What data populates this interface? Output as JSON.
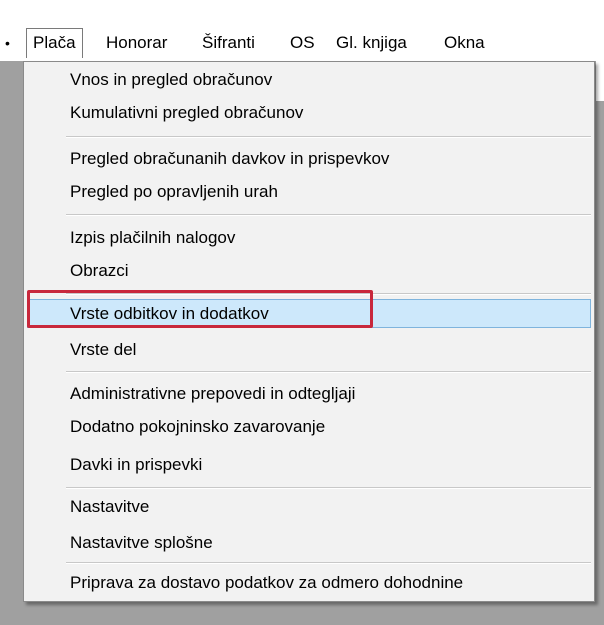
{
  "menubar": {
    "edge_dot": "•",
    "items": [
      {
        "label": "Plača",
        "active": true
      },
      {
        "label": "Honorar",
        "active": false
      },
      {
        "label": "Šifranti",
        "active": false
      },
      {
        "label": "OS",
        "active": false
      },
      {
        "label": "Gl. knjiga",
        "active": false
      },
      {
        "label": "Okna",
        "active": false
      }
    ]
  },
  "dropdown": {
    "items": [
      {
        "label": "Vnos in pregled obračunov"
      },
      {
        "label": "Kumulativni pregled obračunov"
      },
      {
        "label": "Pregled obračunanih davkov in prispevkov"
      },
      {
        "label": "Pregled po opravljenih urah"
      },
      {
        "label": "Izpis plačilnih nalogov"
      },
      {
        "label": "Obrazci"
      },
      {
        "label": "Vrste odbitkov in dodatkov",
        "highlighted": true
      },
      {
        "label": "Vrste del"
      },
      {
        "label": "Administrativne prepovedi in odtegljaji"
      },
      {
        "label": "Dodatno pokojninsko zavarovanje"
      },
      {
        "label": "Davki in prispevki"
      },
      {
        "label": "Nastavitve"
      },
      {
        "label": "Nastavitve splošne"
      },
      {
        "label": "Priprava za dostavo podatkov za odmero dohodnine"
      }
    ]
  },
  "colors": {
    "highlight_bg": "#cde8fb",
    "highlight_border": "#7fb4dd",
    "annotation_box": "#c8283c",
    "app_background": "#a0a0a0"
  }
}
